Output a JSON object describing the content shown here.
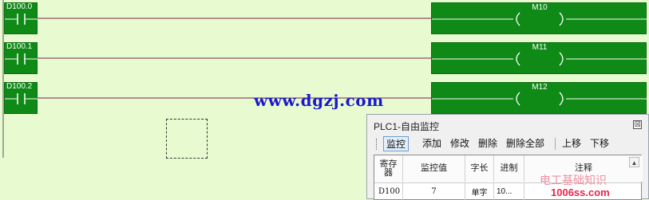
{
  "ladder": {
    "rungs": [
      {
        "contact": "D100.0",
        "coil": "M10"
      },
      {
        "contact": "D100.1",
        "coil": "M11"
      },
      {
        "contact": "D100.2",
        "coil": "M12"
      }
    ]
  },
  "watermark": {
    "url": "www.dgzj.com",
    "cn_text": "电工基础知识",
    "site": "1006ss.com"
  },
  "panel": {
    "title": "PLC1-自由监控",
    "close_glyph": "☒",
    "toolbar": {
      "monitor": "监控",
      "add": "添加",
      "modify": "修改",
      "delete": "删除",
      "delete_all": "删除全部",
      "move_up": "上移",
      "move_down": "下移"
    },
    "table": {
      "headers": [
        "寄存器",
        "监控值",
        "字长",
        "进制",
        "注释"
      ],
      "rows": [
        [
          "D100",
          "7",
          "单字",
          "10..."
        ]
      ]
    }
  },
  "colors": {
    "background": "#e8fbd0",
    "element_fill": "#0f8a17",
    "rung_line": "#7a1f4f"
  }
}
